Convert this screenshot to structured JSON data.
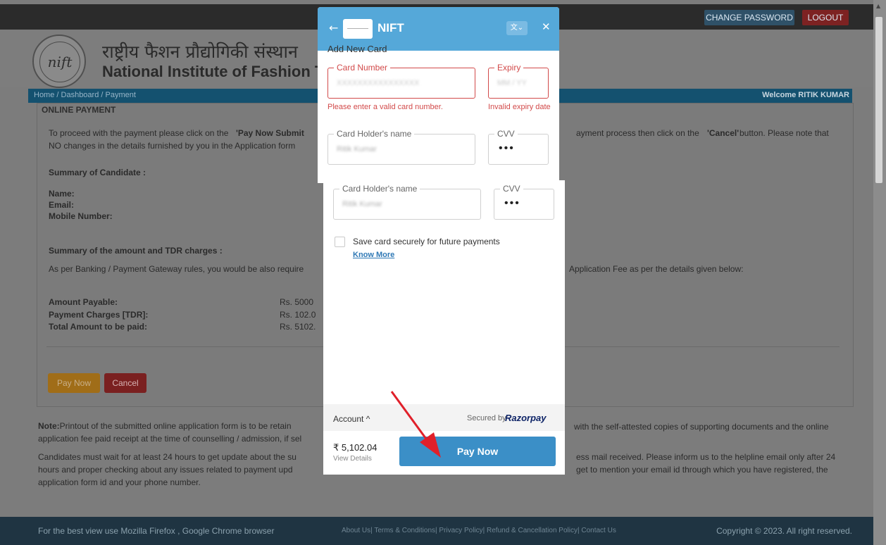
{
  "topbar": {
    "change_password": "CHANGE PASSWORD",
    "logout": "LOGOUT"
  },
  "header": {
    "title_hindi": "राष्ट्रीय फैशन प्रौद्योगिकी संस्थान",
    "title_english": "National Institute of Fashion Tec",
    "logo_text": "nift"
  },
  "breadcrumb": {
    "text": "Home  /  Dashboard  /  Payment",
    "welcome": "Welcome RITIK KUMAR"
  },
  "panel": {
    "title": "ONLINE PAYMENT",
    "intro_line1_start": "To proceed with the payment please click on the ",
    "intro_line1_bold": "'Pay Now Submit",
    "intro_line1_end": "ayment process then click on the ",
    "intro_cancel_bold": "'Cancel'",
    "intro_line1_tail": " button. Please note that",
    "intro_line2": "NO changes in the details furnished by you in the Application form",
    "summary_candidate": "Summary of Candidate :",
    "name_label": "Name:",
    "email_label": "Email:",
    "mobile_label": "Mobile Number:",
    "summary_amount": "Summary of the amount and TDR charges :",
    "banking_text": "As per Banking / Payment Gateway rules, you would be also require",
    "banking_tail": "Application Fee as per the details given below:",
    "amount_payable_label": "Amount Payable:",
    "amount_payable_value": "Rs. 5000",
    "tdr_label": "Payment Charges [TDR]:",
    "tdr_value": "Rs. 102.0",
    "total_label": "Total Amount to be paid:",
    "total_value": "Rs. 5102.",
    "pay_now": "Pay Now",
    "cancel": "Cancel"
  },
  "notes": {
    "note_bold": "Note:",
    "note1_start": "Printout of the submitted online application form is to be retain",
    "note1_end": "with the self-attested copies of supporting documents and the online",
    "note1_line2": "application fee paid receipt at the time of counselling / admission, if sel",
    "note2_start": "Candidates must wait for at least 24 hours to get update about the su",
    "note2_end": "ess mail received. Please inform us to the helpline email only after 24",
    "note2_line2_start": "hours and proper checking about any issues related to payment upd",
    "note2_line2_end": "get to mention your email id through which you have registered, the",
    "note2_line3": "application form id and your phone number."
  },
  "footer": {
    "left": "For the best view use Mozilla Firefox , Google Chrome browser",
    "links": "About Us| Terms & Conditions| Privacy Policy| Refund & Cancellation Policy| Contact Us",
    "right": "Copyright © 2023. All right reserved."
  },
  "modal": {
    "merchant": "NIFT",
    "add_new_card": "Add New Card",
    "card_number_label": "Card Number",
    "card_number_value": "XXXXXXXXXXXXXXXX",
    "card_number_error": "Please enter a valid card number.",
    "expiry_label": "Expiry",
    "expiry_value": "MM / YY",
    "expiry_error": "Invalid expiry date",
    "holder_label": "Card Holder's name",
    "holder_value": "Ritik Kumar",
    "cvv_label": "CVV",
    "cvv_value": "•••",
    "save_card": "Save card securely for future payments",
    "know_more": "Know More",
    "account": "Account ^",
    "secured_by": "Secured by",
    "razorpay": "Razorpay",
    "amount": "₹ 5,102.04",
    "view_details": "View Details",
    "pay_now": "Pay Now"
  },
  "colors": {
    "accent": "#55a8d9",
    "pay_button": "#3b8fc7",
    "error": "#d24a4a",
    "arrow": "#e0202a"
  },
  "icons": [
    "back-arrow-icon",
    "translate-icon",
    "close-icon",
    "checkbox-icon",
    "chevron-up-icon"
  ]
}
